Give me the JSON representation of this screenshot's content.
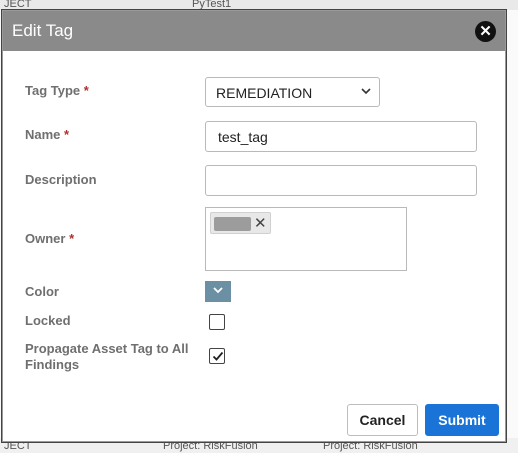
{
  "background": {
    "top_left_text": "JECT",
    "top_mid_text": "PyTest1",
    "bottom_left_text": "JECT",
    "bottom_mid_text": "Project: RiskFusion",
    "bottom_right_text": "Project: RiskFusion"
  },
  "dialog": {
    "title": "Edit Tag",
    "close_icon": "close-icon"
  },
  "form": {
    "tag_type_label": "Tag Type",
    "tag_type_value": "REMEDIATION",
    "name_label": "Name",
    "name_value": "test_tag",
    "description_label": "Description",
    "description_value": "",
    "owner_label": "Owner",
    "owner_remove_glyph": "✕",
    "color_label": "Color",
    "color_value": "#6b8fa3",
    "locked_label": "Locked",
    "locked_checked": false,
    "propagate_label_line1": "Propagate Asset Tag to All",
    "propagate_label_line2": "Findings",
    "propagate_checked": true,
    "required_marker": "*"
  },
  "actions": {
    "cancel_label": "Cancel",
    "submit_label": "Submit"
  }
}
